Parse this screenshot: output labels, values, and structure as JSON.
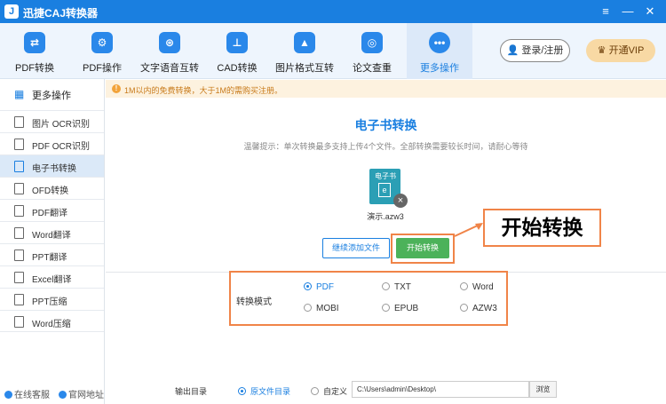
{
  "app": {
    "title": "迅捷CAJ转换器",
    "logo_char": "J"
  },
  "window_controls": {
    "menu": "≡",
    "minimize": "—",
    "close": "✕"
  },
  "toolbar": {
    "items": [
      {
        "label": "PDF转换",
        "icon": "swap-icon",
        "glyph": "⇄"
      },
      {
        "label": "PDF操作",
        "icon": "gear-icon",
        "glyph": "⚙"
      },
      {
        "label": "文字语音互转",
        "icon": "text-voice-icon",
        "glyph": "⊛"
      },
      {
        "label": "CAD转换",
        "icon": "cad-icon",
        "glyph": "⊥"
      },
      {
        "label": "图片格式互转",
        "icon": "image-icon",
        "glyph": "▲"
      },
      {
        "label": "论文查重",
        "icon": "check-icon",
        "glyph": "◎"
      },
      {
        "label": "更多操作",
        "icon": "more-icon",
        "glyph": "•••"
      }
    ],
    "login_label": "登录/注册",
    "vip_label": "开通VIP"
  },
  "sidebar": {
    "header": "更多操作",
    "items": [
      "图片 OCR识别",
      "PDF OCR识别",
      "电子书转换",
      "OFD转换",
      "PDF翻译",
      "Word翻译",
      "PPT翻译",
      "Excel翻译",
      "PPT压缩",
      "Word压缩"
    ],
    "active_index": 2,
    "footer": {
      "service": "在线客服",
      "website": "官网地址"
    }
  },
  "notice": {
    "icon": "!",
    "text": "1M以内的免费转换，大于1M的需购买注册。"
  },
  "main": {
    "title": "电子书转换",
    "tip": "温馨提示：单次转换最多支持上传4个文件。全部转换需要较长时间，请耐心等待",
    "file": {
      "badge": "电子书",
      "letter": "e",
      "name": "演示.azw3"
    },
    "add_button": "继续添加文件",
    "start_button": "开始转换",
    "callout": "开始转换",
    "mode_label": "转换模式",
    "modes": [
      "PDF",
      "TXT",
      "Word",
      "MOBI",
      "EPUB",
      "AZW3"
    ],
    "selected_mode": "PDF",
    "output_label": "输出目录",
    "output_options": [
      "原文件目录",
      "自定义"
    ],
    "output_selected": "原文件目录",
    "output_path": "C:\\Users\\admin\\Desktop\\",
    "browse_button": "浏览"
  },
  "colors": {
    "brand": "#1a7fe0",
    "highlight": "#f08448",
    "start": "#4cb25a",
    "notice_bg": "#fdf2df"
  }
}
